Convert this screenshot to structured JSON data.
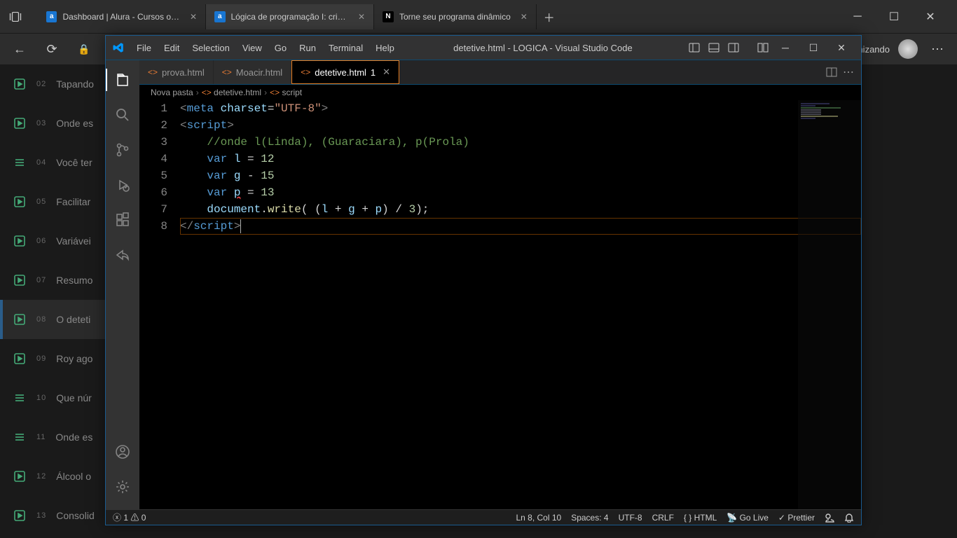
{
  "browser": {
    "tabs": [
      {
        "icon": "a",
        "label": "Dashboard | Alura - Cursos onlin"
      },
      {
        "icon": "a",
        "label": "Lógica de programação I: crie pr"
      },
      {
        "icon": "N",
        "label": "Torne seu programa dinâmico"
      }
    ],
    "nav_right_text": "nizando"
  },
  "alura_sidebar": [
    {
      "num": "02",
      "label": "Tapando",
      "icon": "play"
    },
    {
      "num": "03",
      "label": "Onde es",
      "icon": "play"
    },
    {
      "num": "04",
      "label": "Você ter",
      "icon": "list"
    },
    {
      "num": "05",
      "label": "Facilitar",
      "icon": "play"
    },
    {
      "num": "06",
      "label": "Variávei",
      "icon": "play"
    },
    {
      "num": "07",
      "label": "Resumo",
      "icon": "play"
    },
    {
      "num": "08",
      "label": "O deteti",
      "icon": "play",
      "active": true
    },
    {
      "num": "09",
      "label": "Roy ago",
      "icon": "play"
    },
    {
      "num": "10",
      "label": "Que núr",
      "icon": "list"
    },
    {
      "num": "11",
      "label": "Onde es",
      "icon": "list"
    },
    {
      "num": "12",
      "label": "Álcool o",
      "icon": "play"
    },
    {
      "num": "13",
      "label": "Consolid",
      "icon": "play"
    }
  ],
  "vscode": {
    "menu": [
      "File",
      "Edit",
      "Selection",
      "View",
      "Go",
      "Run",
      "Terminal",
      "Help"
    ],
    "title": "detetive.html - LOGICA - Visual Studio Code",
    "tabs": [
      {
        "name": "prova.html",
        "modified": false,
        "active": false
      },
      {
        "name": "Moacir.html",
        "modified": false,
        "active": false
      },
      {
        "name": "detetive.html",
        "modified": true,
        "modcount": "1",
        "active": true
      }
    ],
    "breadcrumb": [
      "Nova pasta",
      "detetive.html",
      "script"
    ],
    "code_lines": [
      {
        "n": 1,
        "html": "<span class='tok-tag'>&lt;</span><span class='tok-tagname'>meta</span> <span class='tok-attr'>charset</span><span class='tok-op'>=</span><span class='tok-str'>\"UTF-8\"</span><span class='tok-tag'>&gt;</span>"
      },
      {
        "n": 2,
        "html": "<span class='tok-tag'>&lt;</span><span class='tok-tagname'>script</span><span class='tok-tag'>&gt;</span>"
      },
      {
        "n": 3,
        "html": "    <span class='tok-comment'>//onde l(Linda), (Guaraciara), p(Prola)</span>"
      },
      {
        "n": 4,
        "html": "    <span class='tok-kw'>var</span> <span class='tok-var'>l</span> <span class='tok-op'>=</span> <span class='tok-num'>12</span>"
      },
      {
        "n": 5,
        "html": "    <span class='tok-kw'>var</span> <span class='tok-var'>g</span> <span class='tok-op'>-</span> <span class='tok-num'>15</span>"
      },
      {
        "n": 6,
        "html": "    <span class='tok-kw'>var</span> <span class='tok-var squiggle'>p</span> <span class='tok-op'>=</span> <span class='tok-num'>13</span>"
      },
      {
        "n": 7,
        "html": "    <span class='tok-obj'>document</span><span class='tok-op'>.</span><span class='tok-func'>write</span><span class='tok-op'>(</span> <span class='tok-op'>(</span><span class='tok-var'>l</span> <span class='tok-op'>+</span> <span class='tok-var'>g</span> <span class='tok-op'>+</span> <span class='tok-var'>p</span><span class='tok-op'>)</span> <span class='tok-op'>/</span> <span class='tok-num'>3</span><span class='tok-op'>);</span>"
      },
      {
        "n": 8,
        "html": "<span class='tok-tag'>&lt;/</span><span class='tok-tagname'>script</span><span class='tok-tag'>&gt;</span><span class='cursor-caret'></span>",
        "active": true
      }
    ],
    "status": {
      "errors": "1",
      "warnings": "0",
      "cursor": "Ln 8, Col 10",
      "spaces": "Spaces: 4",
      "encoding": "UTF-8",
      "eol": "CRLF",
      "lang": "HTML",
      "golive": "Go Live",
      "prettier": "Prettier"
    }
  }
}
